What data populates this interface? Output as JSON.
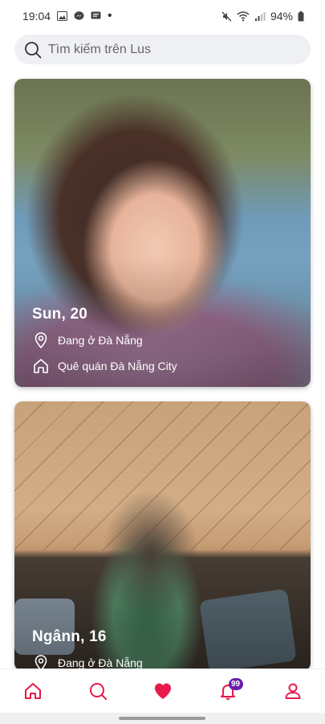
{
  "status_bar": {
    "time": "19:04",
    "battery": "94%"
  },
  "search": {
    "placeholder": "Tìm kiếm trên Lus"
  },
  "cards": [
    {
      "name_age": "Sun, 20",
      "location": "Đang ở Đà Nẵng",
      "hometown": "Quê quán Đà Nẵng City"
    },
    {
      "name_age": "Ngânn, 16",
      "location": "Đang ở Đà Nẵng"
    }
  ],
  "bottom_nav": {
    "items": [
      "home-icon",
      "search-icon",
      "heart-icon",
      "bell-icon",
      "profile-icon"
    ],
    "notification_count": "99"
  },
  "colors": {
    "accent": "#e8194b",
    "badge": "#6a1fb0",
    "search_bg": "#eef0f3"
  }
}
